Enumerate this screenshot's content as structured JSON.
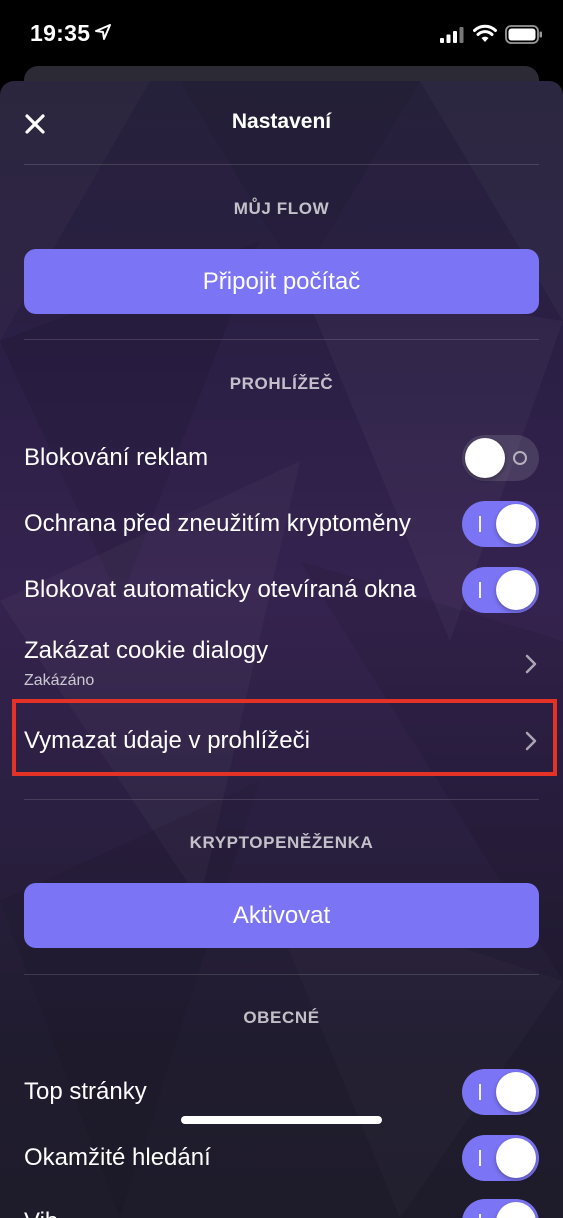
{
  "status_bar": {
    "time": "19:35"
  },
  "header": {
    "title": "Nastavení"
  },
  "sections": {
    "my_flow": {
      "title": "MŮJ FLOW",
      "button": "Připojit počítač"
    },
    "browser": {
      "title": "PROHLÍŽEČ",
      "items": [
        {
          "label": "Blokování reklam",
          "toggle": false
        },
        {
          "label": "Ochrana před zneužitím kryptoměny",
          "toggle": true
        },
        {
          "label": "Blokovat automaticky otevíraná okna",
          "toggle": true
        },
        {
          "label": "Zakázat cookie dialogy",
          "subtitle": "Zakázáno"
        },
        {
          "label": "Vymazat údaje v prohlížeči"
        }
      ]
    },
    "wallet": {
      "title": "KRYPTOPENĚŽENKA",
      "button": "Aktivovat"
    },
    "general": {
      "title": "OBECNÉ",
      "items": [
        {
          "label": "Top stránky",
          "toggle": true
        },
        {
          "label": "Okamžité hledání",
          "toggle": true
        },
        {
          "label": "Vib",
          "toggle": true
        }
      ]
    }
  },
  "colors": {
    "accent": "#7b74f4",
    "highlight": "#e53226",
    "background": "#2b1f45"
  }
}
